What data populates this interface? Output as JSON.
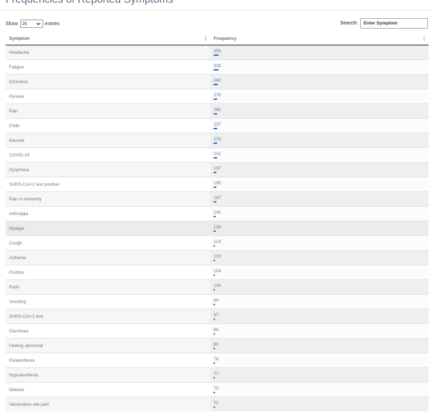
{
  "page": {
    "title": "Frequencies of Reported Symptoms"
  },
  "controls": {
    "show_label": "Show",
    "page_length": "25",
    "entries_label": "entries",
    "search_label": "Search:",
    "search_placeholder": "Enter Symptom"
  },
  "table": {
    "columns": [
      "Symptom",
      "Frequency"
    ],
    "max_frequency": 355,
    "bar_color": "#2f6fbf",
    "rows": [
      {
        "symptom": "Headache",
        "frequency": 355
      },
      {
        "symptom": "Fatigue",
        "frequency": 339
      },
      {
        "symptom": "Dizziness",
        "frequency": 280
      },
      {
        "symptom": "Pyrexia",
        "frequency": 276
      },
      {
        "symptom": "Pain",
        "frequency": 260
      },
      {
        "symptom": "Chills",
        "frequency": 237
      },
      {
        "symptom": "Nausea",
        "frequency": 233
      },
      {
        "symptom": "COVID-19",
        "frequency": 231
      },
      {
        "symptom": "Dyspnoea",
        "frequency": 197
      },
      {
        "symptom": "SARS-CoV-2 test positive",
        "frequency": 195
      },
      {
        "symptom": "Pain in extremity",
        "frequency": 187
      },
      {
        "symptom": "Arthralgia",
        "frequency": 145
      },
      {
        "symptom": "Myalgia",
        "frequency": 129
      },
      {
        "symptom": "Cough",
        "frequency": 124
      },
      {
        "symptom": "Asthenia",
        "frequency": 119
      },
      {
        "symptom": "Pruritus",
        "frequency": 104
      },
      {
        "symptom": "Rash",
        "frequency": 100
      },
      {
        "symptom": "Vomiting",
        "frequency": 99
      },
      {
        "symptom": "SARS-CoV-2 test",
        "frequency": 97
      },
      {
        "symptom": "Diarrhoea",
        "frequency": 86
      },
      {
        "symptom": "Feeling abnormal",
        "frequency": 80
      },
      {
        "symptom": "Paraesthesia",
        "frequency": 78
      },
      {
        "symptom": "Hypoaesthesia",
        "frequency": 77
      },
      {
        "symptom": "Malaise",
        "frequency": 75
      },
      {
        "symptom": "Vaccination site pain",
        "frequency": 72
      }
    ]
  }
}
